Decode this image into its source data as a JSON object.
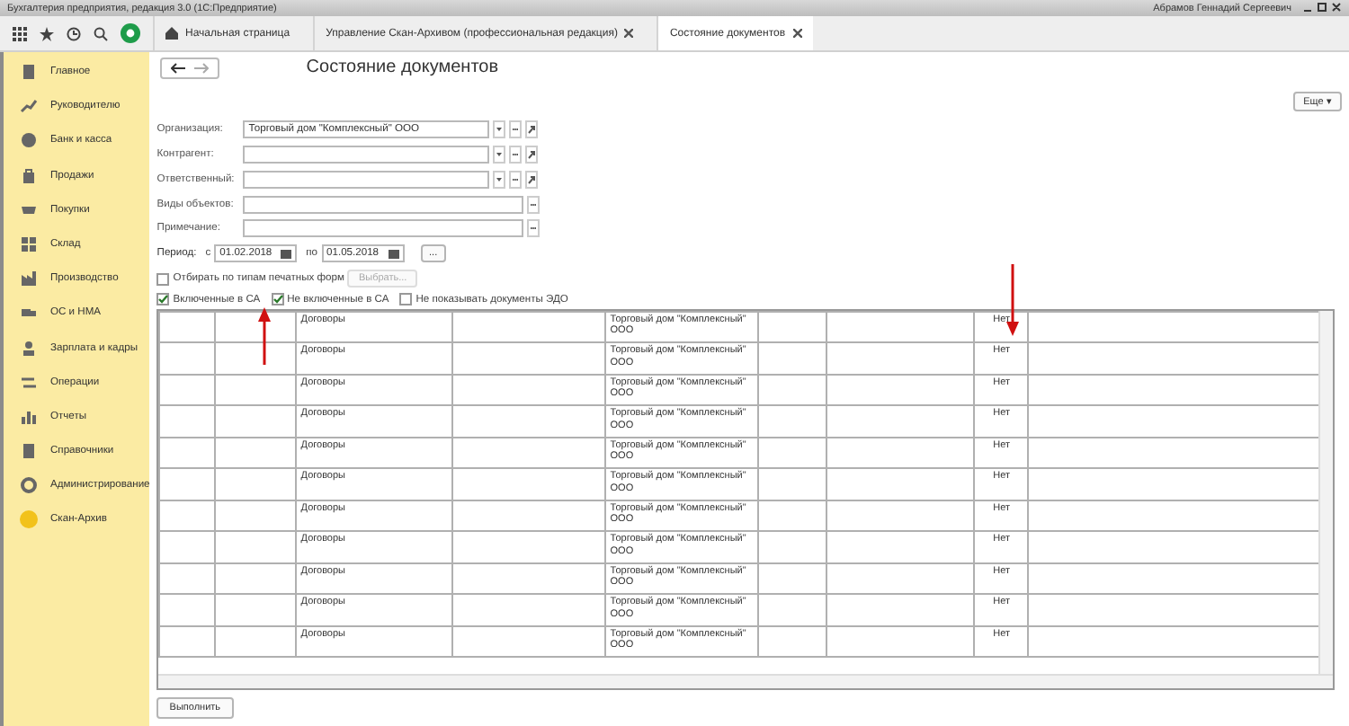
{
  "window": {
    "title": "Бухгалтерия предприятия, редакция 3.0 (1С:Предприятие)",
    "user": "Абрамов Геннадий Сергеевич"
  },
  "tabs": [
    {
      "label": "Начальная страница",
      "kind": "home",
      "selected": false
    },
    {
      "label": "Управление Скан-Архивом (профессиональная редакция)",
      "kind": "closable",
      "selected": false
    },
    {
      "label": "Состояние документов",
      "kind": "closable",
      "selected": true
    }
  ],
  "sidebar": {
    "items": [
      {
        "label": "Главное",
        "kind": "list"
      },
      {
        "label": "Руководителю",
        "kind": "trend"
      },
      {
        "label": "Банк и касса",
        "kind": "coin"
      },
      {
        "label": "Продажи",
        "kind": "bag"
      },
      {
        "label": "Покупки",
        "kind": "cart"
      },
      {
        "label": "Склад",
        "kind": "grid"
      },
      {
        "label": "Производство",
        "kind": "factory"
      },
      {
        "label": "ОС и НМА",
        "kind": "truck"
      },
      {
        "label": "Зарплата и кадры",
        "kind": "person"
      },
      {
        "label": "Операции",
        "kind": "swap"
      },
      {
        "label": "Отчеты",
        "kind": "bars"
      },
      {
        "label": "Справочники",
        "kind": "book"
      },
      {
        "label": "Администрирование",
        "kind": "gear"
      },
      {
        "label": "Скан-Архив",
        "kind": "circle"
      }
    ]
  },
  "form": {
    "title": "Состояние документов",
    "more_button": "Еще ▾",
    "fields": [
      {
        "label": "Организация:",
        "value": "Торговый дом \"Комплексный\" ООО",
        "kind": "ref"
      },
      {
        "label": "Контрагент:",
        "kind": "ref"
      },
      {
        "label": "Ответственный:",
        "kind": "ref"
      },
      {
        "label": "Виды объектов:",
        "kind": "select"
      },
      {
        "label": "Примечание:",
        "kind": "select"
      }
    ],
    "period": {
      "label": "Период:",
      "from_label": "с",
      "from": "01.02.2018",
      "to_label": "по",
      "to": "01.05.2018",
      "button": "..."
    },
    "print_filter": {
      "label": "Отбирать по типам печатных форм",
      "checked": false,
      "button": "Выбрать...",
      "button_disabled": true
    },
    "options": [
      {
        "label": "Включенные в СА",
        "checked": true
      },
      {
        "label": "Не включенные в СА",
        "checked": true
      },
      {
        "label": "Не показывать документы ЭДО",
        "checked": false
      }
    ],
    "run_button": "Выполнить"
  },
  "table": {
    "rows": [
      {
        "column_3": "Договоры",
        "column_5": "Торговый дом \"Комплексный\" ООО",
        "column_8": "Нет"
      },
      {
        "column_3": "Договоры",
        "column_5": "Торговый дом \"Комплексный\" ООО",
        "column_8": "Нет"
      },
      {
        "column_3": "Договоры",
        "column_5": "Торговый дом \"Комплексный\" ООО",
        "column_8": "Нет"
      },
      {
        "column_3": "Договоры",
        "column_5": "Торговый дом \"Комплексный\" ООО",
        "column_8": "Нет"
      },
      {
        "column_3": "Договоры",
        "column_5": "Торговый дом \"Комплексный\" ООО",
        "column_8": "Нет"
      },
      {
        "column_3": "Договоры",
        "column_5": "Торговый дом \"Комплексный\" ООО",
        "column_8": "Нет"
      },
      {
        "column_3": "Договоры",
        "column_5": "Торговый дом \"Комплексный\" ООО",
        "column_8": "Нет"
      },
      {
        "column_3": "Договоры",
        "column_5": "Торговый дом \"Комплексный\" ООО",
        "column_8": "Нет"
      },
      {
        "column_3": "Договоры",
        "column_5": "Торговый дом \"Комплексный\" ООО",
        "column_8": "Нет"
      },
      {
        "column_3": "Договоры",
        "column_5": "Торговый дом \"Комплексный\" ООО",
        "column_8": "Нет"
      },
      {
        "column_3": "Договоры",
        "column_5": "Торговый дом \"Комплексный\" ООО",
        "column_8": "Нет"
      }
    ]
  }
}
